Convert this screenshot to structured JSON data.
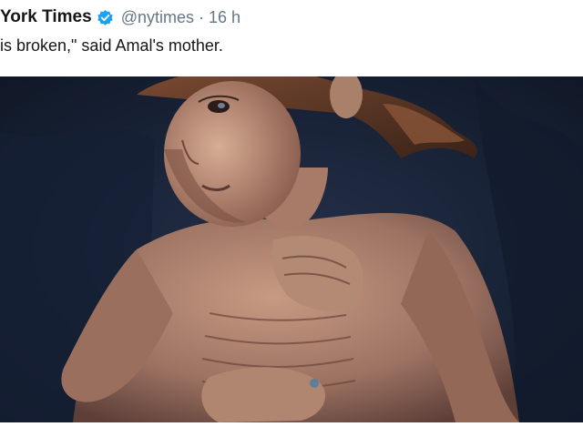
{
  "tweet": {
    "author_name": "York Times",
    "verified_icon": "verified-badge-icon",
    "handle": "@nytimes",
    "separator": "·",
    "time": "16 h",
    "text": "is broken,\" said Amal's mother.",
    "media": {
      "kind": "photo"
    }
  },
  "colors": {
    "name": "#14171a",
    "secondary": "#657786",
    "verified": "#1da1f2",
    "photo_background": "#172133"
  }
}
